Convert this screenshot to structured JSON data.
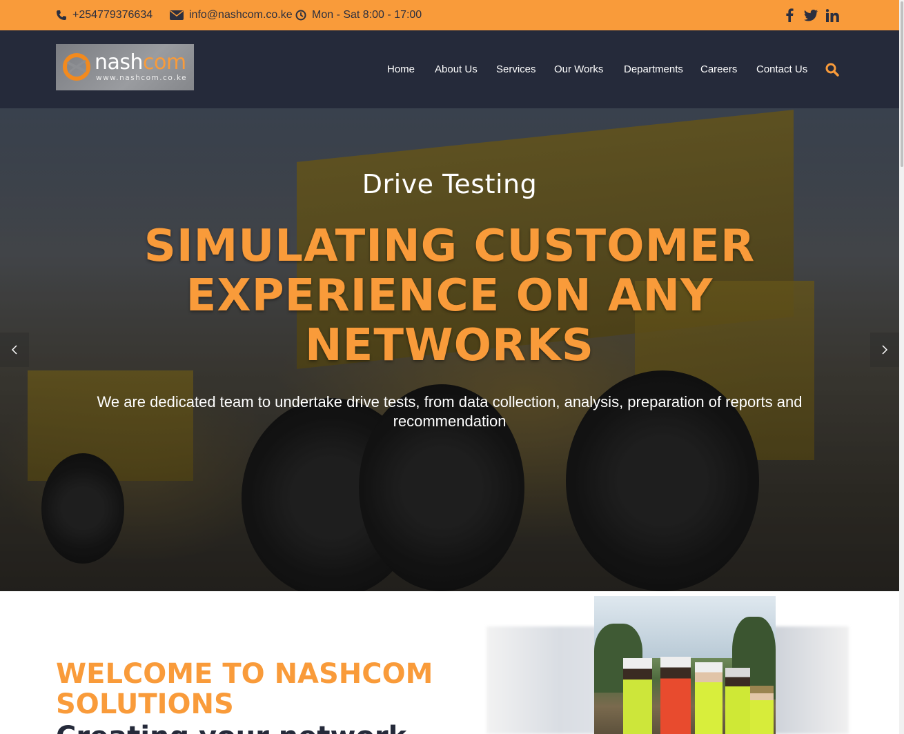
{
  "topbar": {
    "phone": "+254779376634",
    "email": "info@nashcom.co.ke",
    "hours": "Mon - Sat 8:00 - 17:00",
    "social_icons": [
      "facebook-icon",
      "twitter-icon",
      "linkedin-icon"
    ]
  },
  "logo": {
    "name_prefix": "nash",
    "name_suffix": "com",
    "url": "www.nashcom.co.ke"
  },
  "nav": {
    "items": [
      "Home",
      "About Us",
      "Services",
      "Our Works",
      "Departments",
      "Careers",
      "Contact Us"
    ],
    "search_icon": "search-icon"
  },
  "hero": {
    "subtitle": "Drive Testing",
    "title": "SIMULATING CUSTOMER EXPERIENCE ON ANY NETWORKS",
    "description": "We are dedicated team to undertake drive tests, from data collection, analysis, preparation of reports and recommendation"
  },
  "welcome": {
    "title": "WELCOME TO NASHCOM SOLUTIONS",
    "subtitle": "Creating your network"
  },
  "colors": {
    "accent": "#f99b3a",
    "header_bg": "#252a3a",
    "text_dark": "#2b2f3f"
  }
}
